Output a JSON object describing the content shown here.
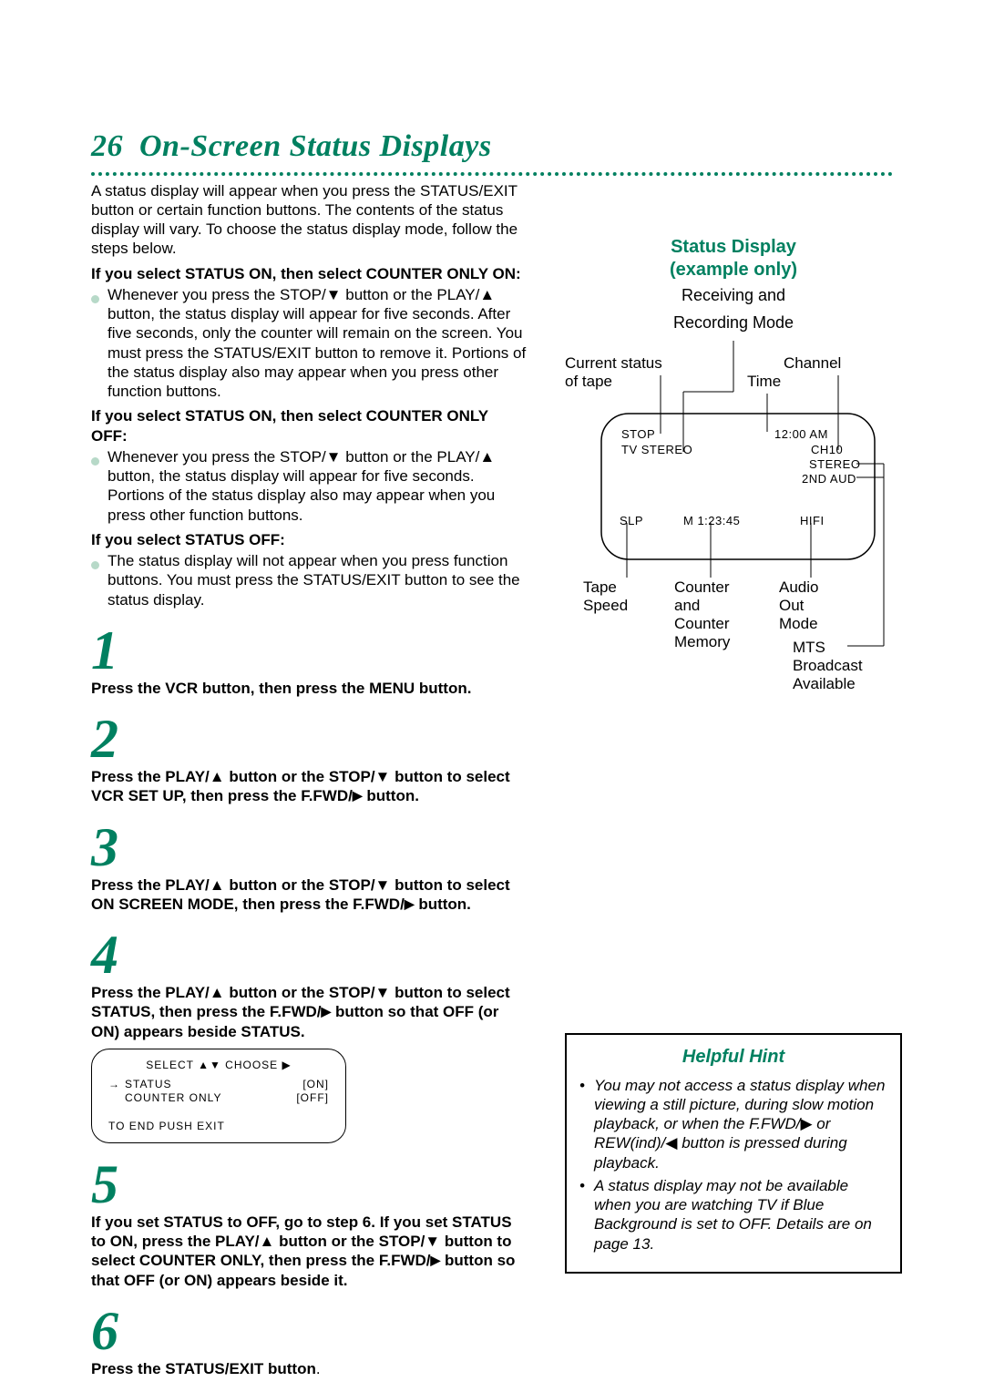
{
  "title_num": "26",
  "title_text": "On-Screen Status Displays",
  "intro": "A status display will appear when you press the STATUS/EXIT button or certain function buttons. The contents of the status display will vary. To choose the status display mode, follow the steps below.",
  "sections": {
    "h1": "If you select STATUS ON, then select COUNTER ONLY ON:",
    "b1": "Whenever you press the STOP/▼ button or the PLAY/▲ button, the status display will appear for five seconds. After five seconds, only the counter will remain on the screen. You must press the STATUS/EXIT button to remove it. Portions of the status display also may appear when you press other function buttons.",
    "h2": "If you select STATUS ON, then select COUNTER ONLY OFF:",
    "b2": "Whenever you press the STOP/▼ button or the PLAY/▲ button, the status display will appear for five seconds. Portions of the status display also may appear when you press other function buttons.",
    "h3": "If you select STATUS OFF:",
    "b3": "The status display will not appear when you press function buttons. You must press the STATUS/EXIT button to see the status display."
  },
  "steps": {
    "s1": "Press the VCR button, then press the MENU button.",
    "s2_a": "Press the PLAY/▲ button or the STOP/▼ button to select VCR SET UP, then press the F.FWD/",
    "s2_b": " button.",
    "s3_a": "Press the PLAY/▲ button or the STOP/▼ button to select ON SCREEN MODE, then press the F.FWD/",
    "s3_b": " button.",
    "s4_a": "Press the PLAY/▲ button or the STOP/▼ button to select STATUS, then press the F.FWD/",
    "s4_b": " button so that OFF (or ON) appears beside STATUS.",
    "s5_a": "If you set STATUS to OFF, go to step 6. If you set STATUS to ON, press the PLAY/▲ button or the STOP/▼ button to select COUNTER ONLY, then press the F.FWD/",
    "s5_b": " button so that OFF (or ON) appears beside it.",
    "s6_a": "Press the STATUS/EXIT button",
    "s6_b": "."
  },
  "stepnums": {
    "n1": "1",
    "n2": "2",
    "n3": "3",
    "n4": "4",
    "n5": "5",
    "n6": "6"
  },
  "osd": {
    "title": "SELECT ▲▼ CHOOSE ▶",
    "status_arrow": "→",
    "status_lbl": "STATUS",
    "status_val": "[ON]",
    "counter_lbl": "COUNTER ONLY",
    "counter_val": "[OFF]",
    "end": "TO END PUSH EXIT"
  },
  "sd": {
    "heading1": "Status Display",
    "heading2": "(example only)",
    "sub1": "Receiving and",
    "sub2": "Recording Mode",
    "label_current1": "Current status",
    "label_current2": "of tape",
    "label_channel": "Channel",
    "label_time": "Time",
    "label_tape1": "Tape",
    "label_tape2": "Speed",
    "label_counter1": "Counter",
    "label_counter2": "and",
    "label_counter3": "Counter",
    "label_counter4": "Memory",
    "label_audio1": "Audio",
    "label_audio2": "Out",
    "label_audio3": "Mode",
    "label_mts1": "MTS",
    "label_mts2": "Broadcast",
    "label_mts3": "Available",
    "v_stop": "STOP",
    "v_tvstereo": "TV STEREO",
    "v_time": "12:00 AM",
    "v_ch": "CH10",
    "v_stereo": "STEREO",
    "v_2ndaud": "2ND AUD",
    "v_slp": "SLP",
    "v_counter": "M  1:23:45",
    "v_hifi": "HIFI"
  },
  "hint": {
    "title": "Helpful Hint",
    "li1_a": "You may not access a status display when viewing a still picture, during slow motion playback, or when the F.FWD/",
    "li1_b": " or REW(ind)/",
    "li1_c": " button is pressed during playback.",
    "li2": "A status display may not be available when you are watching TV if Blue Background is set to OFF. Details are on page 13."
  },
  "glyphs": {
    "play_right": "▶",
    "rew_left": "◀",
    "bullet": "•"
  }
}
